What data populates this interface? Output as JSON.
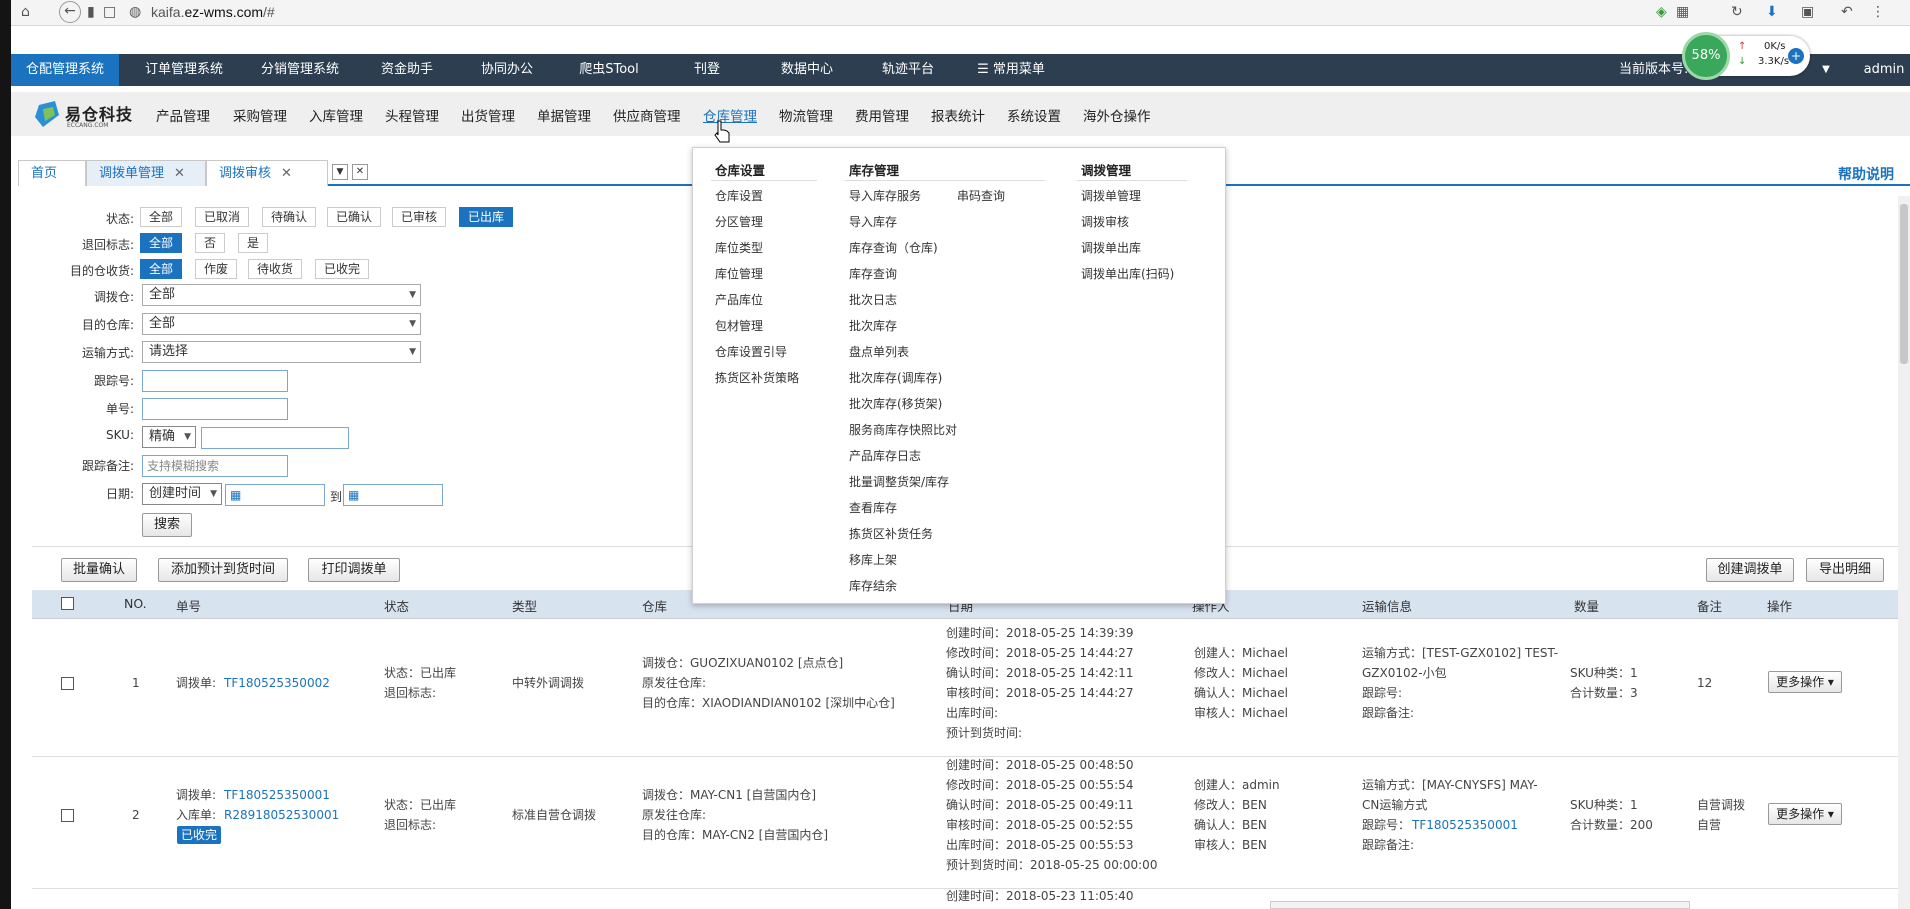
{
  "browser": {
    "url_host": "kaifa.",
    "url_domain": "ez-wms.com",
    "url_path": "/#"
  },
  "system_nav": {
    "items": [
      "仓配管理系统",
      "订单管理系统",
      "分销管理系统",
      "资金助手",
      "协同办公",
      "爬虫STool",
      "刊登",
      "数据中心",
      "轨迹平台",
      "☰ 常用菜单"
    ],
    "version_label": "当前版本号:D",
    "user": "admin",
    "net_percent": "58%",
    "net_up": "0K/s",
    "net_down": "3.3K/s"
  },
  "module_nav": {
    "logo_text": "易仓科技",
    "logo_sub": "ECCANG.COM",
    "items": [
      "产品管理",
      "采购管理",
      "入库管理",
      "头程管理",
      "出货管理",
      "单据管理",
      "供应商管理",
      "仓库管理",
      "物流管理",
      "费用管理",
      "报表统计",
      "系统设置",
      "海外仓操作"
    ]
  },
  "tabs": {
    "items": [
      "首页",
      "调拨单管理",
      "调拨审核"
    ],
    "help": "帮助说明"
  },
  "filters": {
    "status_label": "状态:",
    "status_options": [
      "全部",
      "已取消",
      "待确认",
      "已确认",
      "已审核",
      "已出库"
    ],
    "return_label": "退回标志:",
    "return_options": [
      "全部",
      "否",
      "是"
    ],
    "dest_label": "目的仓收货:",
    "dest_options": [
      "全部",
      "作废",
      "待收货",
      "已收完"
    ],
    "from_wh_label": "调拨仓:",
    "from_wh_value": "全部",
    "to_wh_label": "目的仓库:",
    "to_wh_value": "全部",
    "ship_label": "运输方式:",
    "ship_value": "请选择",
    "track_label": "跟踪号:",
    "order_label": "单号:",
    "sku_label": "SKU:",
    "sku_mode": "精确",
    "note_label": "跟踪备注:",
    "note_placeholder": "支持模糊搜索",
    "date_label": "日期:",
    "date_type": "创建时间",
    "date_to": "到",
    "search": "搜索"
  },
  "actions": {
    "batch_confirm": "批量确认",
    "add_eta": "添加预计到货时间",
    "print": "打印调拨单",
    "create": "创建调拨单",
    "export": "导出明细"
  },
  "table": {
    "headers": [
      "NO.",
      "单号",
      "状态",
      "类型",
      "仓库",
      "日期",
      "操作人",
      "运输信息",
      "数量",
      "备注",
      "操作"
    ],
    "rows": [
      {
        "no": "1",
        "doc_label": "调拨单:",
        "doc_no": "TF180525350002",
        "status": "状态：已出库\n退回标志:",
        "type": "中转外调调拨",
        "warehouse": "调拨仓：GUOZIXUAN0102 [点点仓]\n原发往仓库:\n目的仓库：XIAODIANDIAN0102 [深圳中心仓]",
        "dates": "创建时间：2018-05-25 14:39:39\n修改时间：2018-05-25 14:44:27\n确认时间：2018-05-25 14:42:11\n审核时间：2018-05-25 14:44:27\n出库时间:\n预计到货时间:",
        "operators": "创建人：Michael\n修改人：Michael\n确认人：Michael\n审核人：Michael",
        "shipping": "运输方式：[TEST-GZX0102] TEST-\nGZX0102-小包\n跟踪号:\n跟踪备注:",
        "qty": "SKU种类：1\n合计数量：3",
        "remark": "12",
        "op": "更多操作"
      },
      {
        "no": "2",
        "doc_label": "调拨单:",
        "doc_no": "TF180525350001",
        "in_label": "入库单:",
        "in_no": "R28918052530001",
        "badge": "已收完",
        "status": "状态：已出库\n退回标志:",
        "type": "标准自营仓调拨",
        "warehouse": "调拨仓：MAY-CN1 [自营国内仓]\n原发往仓库:\n目的仓库：MAY-CN2 [自营国内仓]",
        "dates": "创建时间：2018-05-25 00:48:50\n修改时间：2018-05-25 00:55:54\n确认时间：2018-05-25 00:49:11\n审核时间：2018-05-25 00:52:55\n出库时间：2018-05-25 00:55:53\n预计到货时间：2018-05-25 00:00:00",
        "operators": "创建人：admin\n修改人：BEN\n确认人：BEN\n审核人：BEN",
        "shipping_1": "运输方式：[MAY-CNYSFS] MAY-\nCN运输方式\n跟踪号：",
        "shipping_track": "TF180525350001",
        "shipping_2": "跟踪备注:",
        "qty": "SKU种类：1\n合计数量：200",
        "remark": "自营调拨\n自营",
        "op": "更多操作"
      }
    ],
    "row3_date": "创建时间：2018-05-23 11:05:40"
  },
  "dropdown": {
    "col1_title": "仓库设置",
    "col1": [
      "仓库设置",
      "分区管理",
      "库位类型",
      "库位管理",
      "产品库位",
      "包材管理",
      "仓库设置引导",
      "拣货区补货策略"
    ],
    "col2_title": "库存管理",
    "col2": [
      "导入库存服务",
      "导入库存",
      "库存查询（仓库)",
      "库存查询",
      "批次日志",
      "批次库存",
      "盘点单列表",
      "批次库存(调库存)",
      "批次库存(移货架)",
      "服务商库存快照比对",
      "产品库存日志",
      "批量调整货架/库存",
      "查看库存",
      "拣货区补货任务",
      "移库上架",
      "库存结余"
    ],
    "col2b": "串码查询",
    "col3_title": "调拨管理",
    "col3": [
      "调拨单管理",
      "调拨审核",
      "调拨单出库",
      "调拨单出库(扫码)"
    ]
  }
}
